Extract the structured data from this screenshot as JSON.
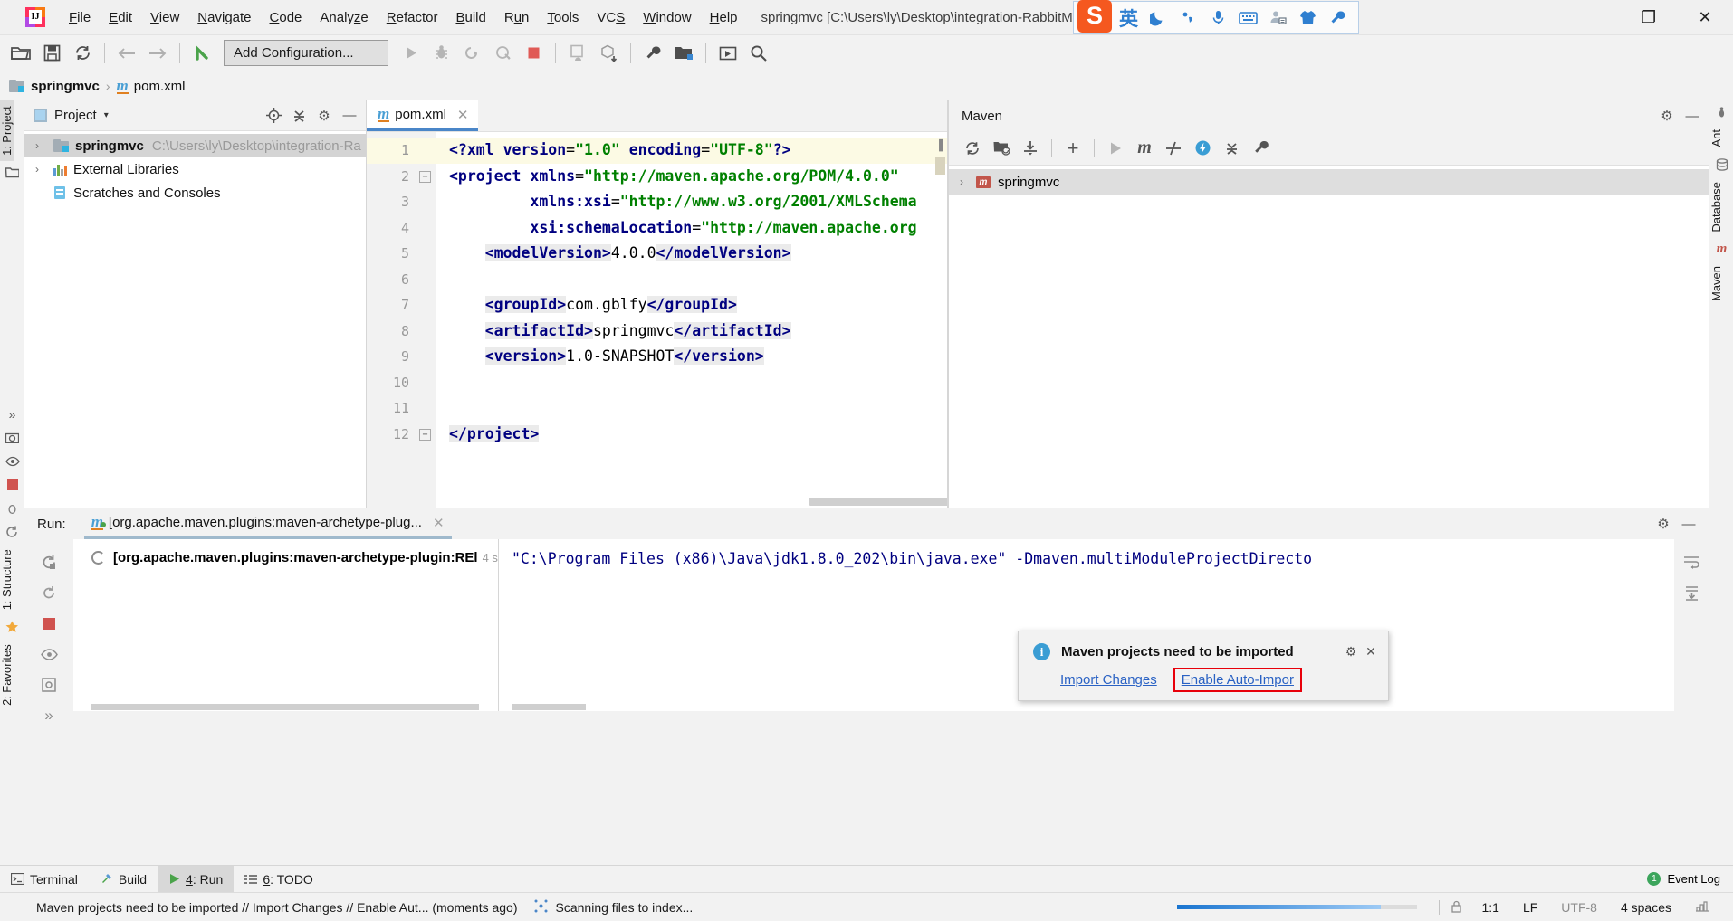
{
  "titlebar": {
    "app_logo": "intellij-idea-logo",
    "menus": [
      "File",
      "Edit",
      "View",
      "Navigate",
      "Code",
      "Analyze",
      "Refactor",
      "Build",
      "Run",
      "Tools",
      "VCS",
      "Window",
      "Help"
    ],
    "window_title": "springmvc [C:\\Users\\ly\\Desktop\\integration-RabbitMQ\\sprin",
    "restore_label": "❐",
    "close_label": "✕"
  },
  "ime": {
    "logo_char": "S",
    "mode_label": "英",
    "moon_icon": "moon-icon",
    "comma_icon": "punctuation-icon",
    "mic_icon": "microphone-icon",
    "keyboard_icon": "soft-keyboard-icon",
    "user_icon": "user-icon",
    "shirt_icon": "skin-icon",
    "wrench_icon": "toolbox-icon"
  },
  "toolbar": {
    "open_label": "🗁",
    "save_label": "💾",
    "sync_label": "⟳",
    "back_label": "←",
    "forward_label": "→",
    "build_label": "⬉",
    "config_button": "Add Configuration...",
    "run_label": "▶",
    "debug_label": "🐞",
    "run_coverage_label": "↻",
    "profile_label": "◔",
    "stop_label": "■",
    "avd_label": "▢",
    "sdk_label": "⬇",
    "settings_label": "🔧",
    "project_structure_label": "🗂",
    "update_label": "▷",
    "search_label": "🔍"
  },
  "breadcrumb": {
    "project_name": "springmvc",
    "separator": "›",
    "file_name": "pom.xml",
    "maven_icon_char": "m"
  },
  "left_strip": {
    "project_tab": "1: Project",
    "structure_tab": "1: Structure",
    "favorites_tab": "2: Favorites",
    "more_label": "»"
  },
  "right_strip": {
    "ant_tab": "Ant",
    "database_tab": "Database",
    "maven_tab": "Maven"
  },
  "project_panel": {
    "title": "Project",
    "caret": "▾",
    "locate_icon": "⊕",
    "collapse_icon": "≣",
    "settings_icon": "⚙",
    "hide_icon": "—",
    "tree": [
      {
        "arrow": "›",
        "label": "springmvc",
        "path": "C:\\Users\\ly\\Desktop\\integration-Ra",
        "icon": "module-folder-icon",
        "selected": true
      },
      {
        "arrow": "›",
        "label": "External Libraries",
        "path": "",
        "icon": "libraries-icon",
        "selected": false
      },
      {
        "arrow": "",
        "label": "Scratches and Consoles",
        "path": "",
        "icon": "scratches-icon",
        "selected": false
      }
    ]
  },
  "editor": {
    "tab_name": "pom.xml",
    "tab_icon_char": "m",
    "tab_close": "✕",
    "line_numbers": [
      "1",
      "2",
      "3",
      "4",
      "5",
      "6",
      "7",
      "8",
      "9",
      "10",
      "11",
      "12"
    ],
    "current_line": 1,
    "lines": [
      {
        "n": 1,
        "segments": [
          {
            "t": "<?",
            "c": "tg"
          },
          {
            "t": "xml",
            "c": "at"
          },
          {
            "t": " ",
            "c": "tx"
          },
          {
            "t": "version",
            "c": "at"
          },
          {
            "t": "=",
            "c": "tx"
          },
          {
            "t": "\"1.0\"",
            "c": "st"
          },
          {
            "t": " ",
            "c": "tx"
          },
          {
            "t": "encoding",
            "c": "at"
          },
          {
            "t": "=",
            "c": "tx"
          },
          {
            "t": "\"UTF-8\"",
            "c": "st"
          },
          {
            "t": "?>",
            "c": "tg"
          }
        ]
      },
      {
        "n": 2,
        "segments": [
          {
            "t": "<project",
            "c": "tg"
          },
          {
            "t": " ",
            "c": "tx"
          },
          {
            "t": "xmlns",
            "c": "at"
          },
          {
            "t": "=",
            "c": "tx"
          },
          {
            "t": "\"http://maven.apache.org/POM/4.0.0\"",
            "c": "st"
          }
        ]
      },
      {
        "n": 3,
        "segments": [
          {
            "t": "         ",
            "c": "tx"
          },
          {
            "t": "xmlns:xsi",
            "c": "at"
          },
          {
            "t": "=",
            "c": "tx"
          },
          {
            "t": "\"http://www.w3.org/2001/XMLSchema",
            "c": "st"
          }
        ]
      },
      {
        "n": 4,
        "segments": [
          {
            "t": "         ",
            "c": "tx"
          },
          {
            "t": "xsi:schemaLocation",
            "c": "at"
          },
          {
            "t": "=",
            "c": "tx"
          },
          {
            "t": "\"http://maven.apache.org",
            "c": "st"
          }
        ]
      },
      {
        "n": 5,
        "segments": [
          {
            "t": "    ",
            "c": "tx"
          },
          {
            "t": "<modelVersion>",
            "c": "tg hl"
          },
          {
            "t": "4.0.0",
            "c": "tx"
          },
          {
            "t": "</modelVersion>",
            "c": "tg hl"
          }
        ]
      },
      {
        "n": 6,
        "segments": []
      },
      {
        "n": 7,
        "segments": [
          {
            "t": "    ",
            "c": "tx"
          },
          {
            "t": "<groupId>",
            "c": "tg hl"
          },
          {
            "t": "com.gblfy",
            "c": "tx"
          },
          {
            "t": "</groupId>",
            "c": "tg hl"
          }
        ]
      },
      {
        "n": 8,
        "segments": [
          {
            "t": "    ",
            "c": "tx"
          },
          {
            "t": "<artifactId>",
            "c": "tg hl"
          },
          {
            "t": "springmvc",
            "c": "tx"
          },
          {
            "t": "</artifactId>",
            "c": "tg hl"
          }
        ]
      },
      {
        "n": 9,
        "segments": [
          {
            "t": "    ",
            "c": "tx"
          },
          {
            "t": "<version>",
            "c": "tg hl"
          },
          {
            "t": "1.0-SNAPSHOT",
            "c": "tx"
          },
          {
            "t": "</version>",
            "c": "tg hl"
          }
        ]
      },
      {
        "n": 10,
        "segments": []
      },
      {
        "n": 11,
        "segments": []
      },
      {
        "n": 12,
        "segments": [
          {
            "t": "</project>",
            "c": "tg hl"
          }
        ]
      }
    ]
  },
  "maven_panel": {
    "title": "Maven",
    "settings_icon": "⚙",
    "hide_icon": "—",
    "reimport_icon": "⟳",
    "generate_sources_icon": "🗁",
    "download_sources_icon": "⬇",
    "add_icon": "+",
    "run_icon": "▶",
    "execute_goal_icon": "m",
    "toggle_skip_icon": "⫻",
    "toggle_offline_icon": "⚡",
    "collapse_icon": "≣",
    "settings_wrench_icon": "🔧",
    "tree": [
      {
        "arrow": "›",
        "label": "springmvc",
        "icon": "maven-project-icon"
      }
    ]
  },
  "run_panel": {
    "label": "Run:",
    "tab_name": "[org.apache.maven.plugins:maven-archetype-plug...",
    "tab_close": "✕",
    "settings_icon": "⚙",
    "hide_icon": "—",
    "sidebar_icons": [
      "rerun-icon",
      "rerun-failed-icon",
      "stop-icon",
      "show-passed-icon",
      "export-icon",
      "more-icon"
    ],
    "tree_item": "[org.apache.maven.plugins:maven-archetype-plugin:REl",
    "tree_duration": "4 s",
    "console_line": "\"C:\\Program Files (x86)\\Java\\jdk1.8.0_202\\bin\\java.exe\" -Dmaven.multiModuleProjectDirecto",
    "right_icons": [
      "wrap-text-icon",
      "scroll-to-end-icon"
    ]
  },
  "notification": {
    "info_icon_char": "i",
    "title": "Maven projects need to be imported",
    "settings_icon": "⚙",
    "close_icon": "✕",
    "import_changes_label": "Import Changes",
    "enable_auto_import_label": "Enable Auto-Impor",
    "highlight_color": "#e8000a",
    "link_color": "#2a62c4"
  },
  "bottom_tabs": {
    "items": [
      {
        "label": "Terminal",
        "icon": "terminal-icon",
        "active": false
      },
      {
        "label": "Build",
        "icon": "build-hammer-icon",
        "active": false
      },
      {
        "label": "4: Run",
        "icon": "run-play-icon",
        "active": true
      },
      {
        "label": "6: TODO",
        "icon": "todo-list-icon",
        "active": false
      }
    ],
    "event_log_label": "Event Log",
    "event_log_count": "1"
  },
  "statusbar": {
    "message": "Maven projects need to be imported // Import Changes // Enable Aut... (moments ago)",
    "scanning": "Scanning files to index...",
    "scanning_icon": "indexing-icon",
    "caret_position": "1:1",
    "line_separator": "LF",
    "encoding": "UTF-8",
    "indent": "4 spaces",
    "lock_icon": "🔒",
    "progress_percent": 85
  }
}
